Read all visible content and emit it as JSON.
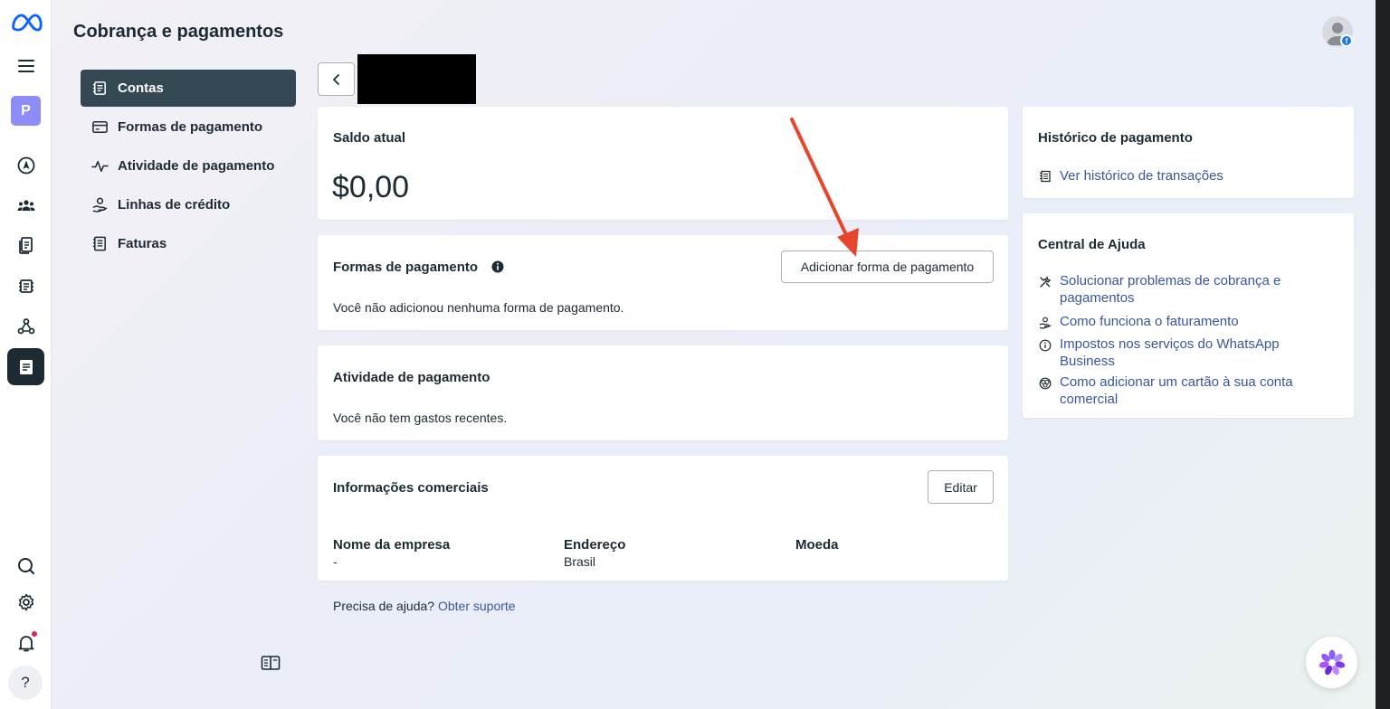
{
  "header": {
    "title": "Cobrança e pagamentos"
  },
  "rail": {
    "avatar_letter": "P",
    "help_label": "?"
  },
  "subnav": {
    "items": [
      {
        "label": "Contas",
        "icon": "accounts-icon",
        "active": true
      },
      {
        "label": "Formas de pagamento",
        "icon": "card-icon",
        "active": false
      },
      {
        "label": "Atividade de pagamento",
        "icon": "activity-icon",
        "active": false
      },
      {
        "label": "Linhas de crédito",
        "icon": "credit-line-icon",
        "active": false
      },
      {
        "label": "Faturas",
        "icon": "invoice-icon",
        "active": false
      }
    ]
  },
  "balance": {
    "title": "Saldo atual",
    "amount": "$0,00"
  },
  "payment_methods": {
    "title": "Formas de pagamento",
    "add_button": "Adicionar forma de pagamento",
    "empty_text": "Você não adicionou nenhuma forma de pagamento."
  },
  "payment_activity": {
    "title": "Atividade de pagamento",
    "empty_text": "Você não tem gastos recentes."
  },
  "business_info": {
    "title": "Informações comerciais",
    "edit_button": "Editar",
    "fields": [
      {
        "label": "Nome da empresa",
        "value": "-"
      },
      {
        "label": "Endereço",
        "value": "Brasil"
      },
      {
        "label": "Moeda",
        "value": ""
      }
    ]
  },
  "footer": {
    "help_text": "Precisa de ajuda?",
    "support_link": "Obter suporte"
  },
  "payment_history": {
    "title": "Histórico de pagamento",
    "link": "Ver histórico de transações"
  },
  "help_center": {
    "title": "Central de Ajuda",
    "links": [
      "Solucionar problemas de cobrança e pagamentos",
      "Como funciona o faturamento",
      "Impostos nos serviços do WhatsApp Business",
      "Como adicionar um cartão à sua conta comercial"
    ]
  },
  "colors": {
    "link": "#385898",
    "active_nav": "#344854",
    "annotation_arrow": "#e8452c"
  }
}
